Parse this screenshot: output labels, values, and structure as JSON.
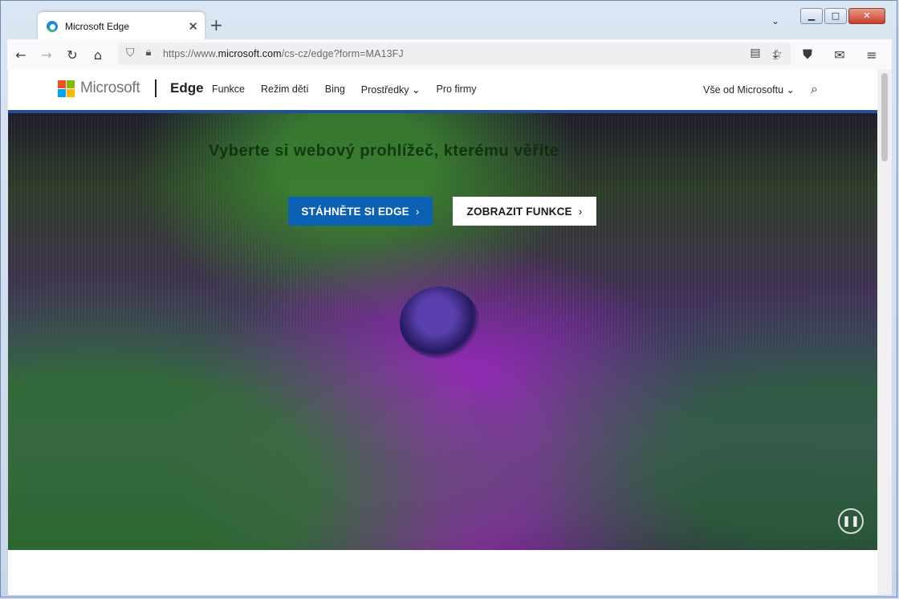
{
  "browser": {
    "tab_title": "Microsoft Edge",
    "url_prefix": "https://www.",
    "url_host": "microsoft.com",
    "url_path": "/cs-cz/edge?form=MA13FJ"
  },
  "site": {
    "brand": "Microsoft",
    "product": "Edge",
    "nav": [
      "Funkce",
      "Režim dětí",
      "Bing",
      "Prostředky",
      "Pro firmy"
    ],
    "nav_right": "Vše od Microsoftu",
    "colors": {
      "red": "#f25022",
      "green": "#7fba00",
      "blue": "#00a4ef",
      "yellow": "#ffb900",
      "primary_button": "#0d61b5"
    }
  },
  "hero": {
    "heading": "Vyberte si webový prohlížeč, kterému věříte",
    "primary_button": "STÁHNĚTE SI EDGE",
    "secondary_button": "ZOBRAZIT FUNKCE"
  }
}
